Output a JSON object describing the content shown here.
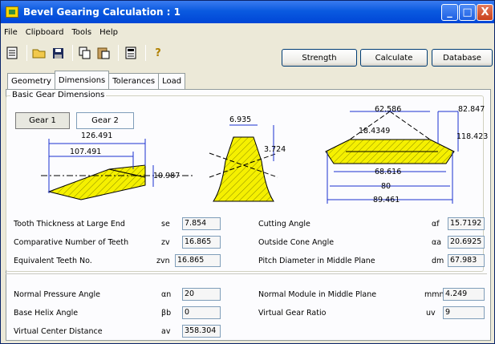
{
  "window": {
    "title": "Bevel Gearing Calculation : 1",
    "min": "_",
    "max": "□",
    "close": "X"
  },
  "menu": [
    "File",
    "Clipboard",
    "Tools",
    "Help"
  ],
  "toolbar": {
    "strength": "Strength",
    "calculate": "Calculate",
    "database": "Database"
  },
  "tabs": [
    "Geometry",
    "Dimensions",
    "Tolerances",
    "Load"
  ],
  "group_label": "Basic Gear Dimensions",
  "gear_buttons": [
    "Gear 1",
    "Gear 2"
  ],
  "drawing": {
    "d126": "126.491",
    "d107": "107.491",
    "d10": "10.987",
    "d6": "6.935",
    "d3": "3.724",
    "d62": "62.586",
    "d82": "82.847",
    "d18": "18.4349",
    "d118": "118.423",
    "d68": "68.616",
    "d80": "80",
    "d89": "89.461"
  },
  "fields": {
    "tooth_thickness": {
      "label": "Tooth Thickness at Large End",
      "sym": "se",
      "value": "7.854"
    },
    "comparative": {
      "label": "Comparative Number of Teeth",
      "sym": "zv",
      "value": "16.865"
    },
    "equivalent": {
      "label": "Equivalent Teeth No.",
      "sym": "zvn",
      "value": "16.865"
    },
    "cutting_angle": {
      "label": "Cutting Angle",
      "sym": "αf",
      "value": "15.7192"
    },
    "outside_cone": {
      "label": "Outside Cone Angle",
      "sym": "αa",
      "value": "20.6925"
    },
    "pitch_diameter": {
      "label": "Pitch Diameter in Middle Plane",
      "sym": "dm",
      "value": "67.983"
    },
    "normal_pressure": {
      "label": "Normal Pressure Angle",
      "sym": "αn",
      "value": "20"
    },
    "base_helix": {
      "label": "Base Helix Angle",
      "sym": "βb",
      "value": "0"
    },
    "virtual_center": {
      "label": "Virtual Center Distance",
      "sym": "av",
      "value": "358.304"
    },
    "normal_module": {
      "label": "Normal Module in Middle Plane",
      "sym": "mmn",
      "value": "4.249"
    },
    "virtual_ratio": {
      "label": "Virtual Gear Ratio",
      "sym": "uv",
      "value": "9"
    }
  },
  "colors": {
    "title": "#0a5ae0",
    "gear_fill": "#f5f000"
  }
}
